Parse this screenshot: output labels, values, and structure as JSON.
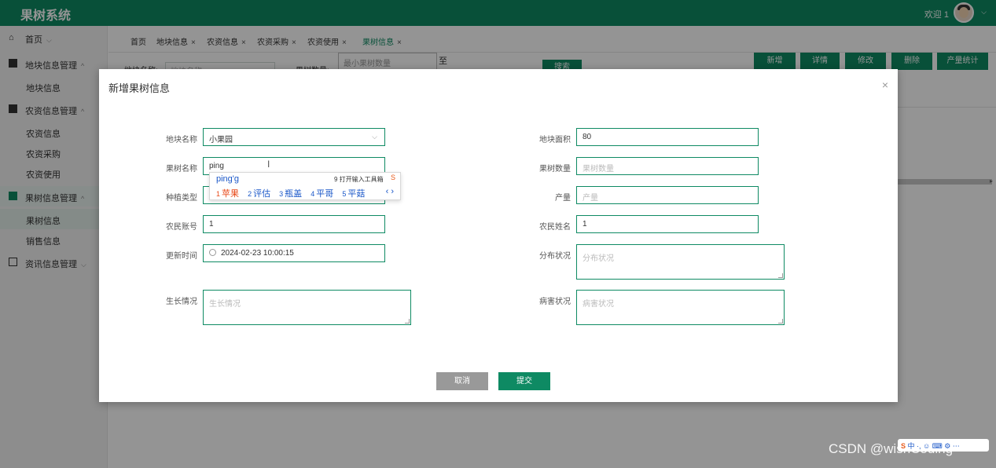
{
  "header": {
    "app_title": "果树系统",
    "welcome": "欢迎 1"
  },
  "sidebar": {
    "home": "首页",
    "groups": [
      {
        "label": "地块信息管理",
        "items": [
          "地块信息"
        ]
      },
      {
        "label": "农资信息管理",
        "items": [
          "农资信息",
          "农资采购",
          "农资使用"
        ]
      },
      {
        "label": "果树信息管理",
        "items": [
          "果树信息",
          "销售信息"
        ]
      },
      {
        "label": "资讯信息管理",
        "items": []
      }
    ]
  },
  "tabs": [
    {
      "label": "首页"
    },
    {
      "label": "地块信息"
    },
    {
      "label": "农资信息"
    },
    {
      "label": "农资采购"
    },
    {
      "label": "农资使用"
    },
    {
      "label": "果树信息"
    }
  ],
  "toolbar": {
    "plot_label": "地块名称:",
    "plot_placeholder": "地块名称",
    "qty_label": "果树数量:",
    "qty_min_placeholder": "最小果树数量",
    "to_label": "至",
    "search": "搜索",
    "buttons": [
      "新增",
      "详情",
      "修改",
      "删除",
      "产量统计"
    ]
  },
  "modal": {
    "title": "新增果树信息",
    "close": "×",
    "fields": {
      "plot_name": {
        "label": "地块名称",
        "value": "小果园"
      },
      "plot_area": {
        "label": "地块面积",
        "value": "80"
      },
      "tree_name": {
        "label": "果树名称",
        "value": "ping"
      },
      "tree_count": {
        "label": "果树数量",
        "placeholder": "果树数量"
      },
      "plant_type": {
        "label": "种植类型"
      },
      "yield": {
        "label": "产量",
        "placeholder": "产量"
      },
      "farmer_account": {
        "label": "农民账号",
        "value": "1"
      },
      "farmer_name": {
        "label": "农民姓名",
        "value": "1"
      },
      "update_time": {
        "label": "更新时间",
        "value": "2024-02-23 10:00:15"
      },
      "distribution": {
        "label": "分布状况",
        "placeholder": "分布状况"
      },
      "growth": {
        "label": "生长情况",
        "placeholder": "生长情况"
      },
      "disease": {
        "label": "病害状况",
        "placeholder": "病害状况"
      }
    },
    "cancel": "取消",
    "submit": "提交"
  },
  "ime": {
    "composition": "ping'g",
    "toolbox": "9 打开输入工具箱",
    "candidates": [
      {
        "num": "1",
        "text": "苹果"
      },
      {
        "num": "2",
        "text": "评估"
      },
      {
        "num": "3",
        "text": "瓶盖"
      },
      {
        "num": "4",
        "text": "平哥"
      },
      {
        "num": "5",
        "text": "平菇"
      }
    ]
  },
  "watermark": "CSDN @wishCoding",
  "tray": "中 ·, ☺ ⌨ ⚙ ⋯"
}
